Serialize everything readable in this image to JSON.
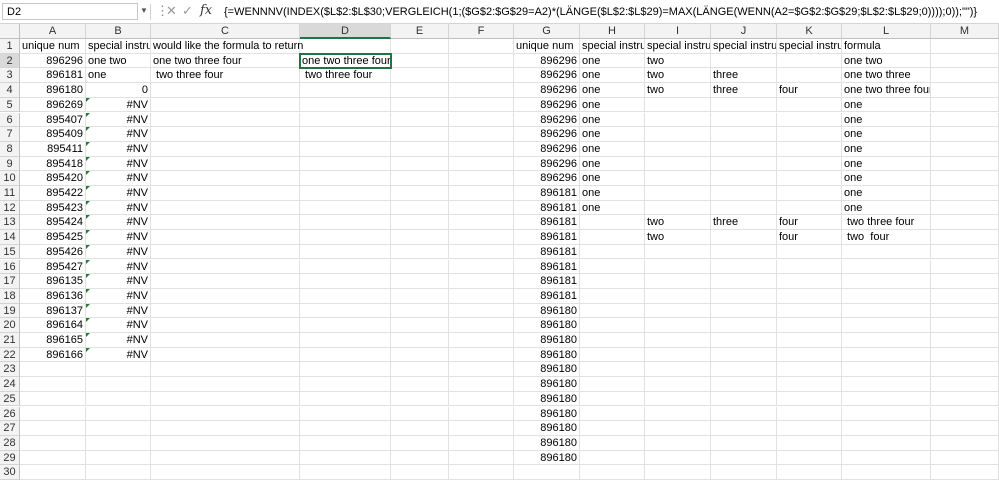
{
  "formula_bar": {
    "name_box": "D2",
    "formula": "{=WENNNV(INDEX($L$2:$L$30;VERGLEICH(1;($G$2:$G$29=A2)*(LÄNGE($L$2:$L$29)=MAX(LÄNGE(WENN(A2=$G$2:$G$29;$L$2:$L$29;0))));0));\"\")}",
    "icons": [
      "more-icon",
      "cancel-icon",
      "enter-icon",
      "insert-function-icon"
    ]
  },
  "columns": [
    "A",
    "B",
    "C",
    "D",
    "E",
    "F",
    "G",
    "H",
    "I",
    "J",
    "K",
    "L",
    "M"
  ],
  "rows": [
    "1",
    "2",
    "3",
    "4",
    "5",
    "6",
    "7",
    "8",
    "9",
    "10",
    "11",
    "12",
    "13",
    "14",
    "15",
    "16",
    "17",
    "18",
    "19",
    "20",
    "21",
    "22",
    "23",
    "24",
    "25",
    "26",
    "27",
    "28",
    "29",
    "30"
  ],
  "selected_cell": "D2",
  "theme": {
    "accent": "#217346",
    "header_bg": "#f3f3f3",
    "grid": "#e1e1e1"
  },
  "cells": [
    {
      "ref": "A1",
      "v": "unique num"
    },
    {
      "ref": "B1",
      "v": "special instruc"
    },
    {
      "ref": "C1",
      "v": "would like the formula to return",
      "ovf": true
    },
    {
      "ref": "A2",
      "v": "896296",
      "r": true
    },
    {
      "ref": "B2",
      "v": "one two"
    },
    {
      "ref": "C2",
      "v": "one two three four"
    },
    {
      "ref": "D2",
      "v": "one two three four"
    },
    {
      "ref": "A3",
      "v": "896181",
      "r": true
    },
    {
      "ref": "B3",
      "v": "one"
    },
    {
      "ref": "C3",
      "v": " two three four"
    },
    {
      "ref": "D3",
      "v": " two three four"
    },
    {
      "ref": "A4",
      "v": "896180",
      "r": true
    },
    {
      "ref": "B4",
      "v": "0",
      "r": true
    },
    {
      "ref": "A5",
      "v": "896269",
      "r": true
    },
    {
      "ref": "B5",
      "v": "#NV",
      "r": true,
      "tri": true
    },
    {
      "ref": "A6",
      "v": "895407",
      "r": true
    },
    {
      "ref": "B6",
      "v": "#NV",
      "r": true,
      "tri": true
    },
    {
      "ref": "A7",
      "v": "895409",
      "r": true
    },
    {
      "ref": "B7",
      "v": "#NV",
      "r": true,
      "tri": true
    },
    {
      "ref": "A8",
      "v": "895411",
      "r": true
    },
    {
      "ref": "B8",
      "v": "#NV",
      "r": true,
      "tri": true
    },
    {
      "ref": "A9",
      "v": "895418",
      "r": true
    },
    {
      "ref": "B9",
      "v": "#NV",
      "r": true,
      "tri": true
    },
    {
      "ref": "A10",
      "v": "895420",
      "r": true
    },
    {
      "ref": "B10",
      "v": "#NV",
      "r": true,
      "tri": true
    },
    {
      "ref": "A11",
      "v": "895422",
      "r": true
    },
    {
      "ref": "B11",
      "v": "#NV",
      "r": true,
      "tri": true
    },
    {
      "ref": "A12",
      "v": "895423",
      "r": true
    },
    {
      "ref": "B12",
      "v": "#NV",
      "r": true,
      "tri": true
    },
    {
      "ref": "A13",
      "v": "895424",
      "r": true
    },
    {
      "ref": "B13",
      "v": "#NV",
      "r": true,
      "tri": true
    },
    {
      "ref": "A14",
      "v": "895425",
      "r": true
    },
    {
      "ref": "B14",
      "v": "#NV",
      "r": true,
      "tri": true
    },
    {
      "ref": "A15",
      "v": "895426",
      "r": true
    },
    {
      "ref": "B15",
      "v": "#NV",
      "r": true,
      "tri": true
    },
    {
      "ref": "A16",
      "v": "895427",
      "r": true
    },
    {
      "ref": "B16",
      "v": "#NV",
      "r": true,
      "tri": true
    },
    {
      "ref": "A17",
      "v": "896135",
      "r": true
    },
    {
      "ref": "B17",
      "v": "#NV",
      "r": true,
      "tri": true
    },
    {
      "ref": "A18",
      "v": "896136",
      "r": true
    },
    {
      "ref": "B18",
      "v": "#NV",
      "r": true,
      "tri": true
    },
    {
      "ref": "A19",
      "v": "896137",
      "r": true
    },
    {
      "ref": "B19",
      "v": "#NV",
      "r": true,
      "tri": true
    },
    {
      "ref": "A20",
      "v": "896164",
      "r": true
    },
    {
      "ref": "B20",
      "v": "#NV",
      "r": true,
      "tri": true
    },
    {
      "ref": "A21",
      "v": "896165",
      "r": true
    },
    {
      "ref": "B21",
      "v": "#NV",
      "r": true,
      "tri": true
    },
    {
      "ref": "A22",
      "v": "896166",
      "r": true
    },
    {
      "ref": "B22",
      "v": "#NV",
      "r": true,
      "tri": true
    },
    {
      "ref": "G1",
      "v": "unique num"
    },
    {
      "ref": "H1",
      "v": "special instruc"
    },
    {
      "ref": "I1",
      "v": "special instruc"
    },
    {
      "ref": "J1",
      "v": "special instruc"
    },
    {
      "ref": "K1",
      "v": "special instruc"
    },
    {
      "ref": "L1",
      "v": "formula"
    },
    {
      "ref": "G2",
      "v": "896296",
      "r": true
    },
    {
      "ref": "H2",
      "v": "one"
    },
    {
      "ref": "I2",
      "v": "two"
    },
    {
      "ref": "L2",
      "v": "one two"
    },
    {
      "ref": "G3",
      "v": "896296",
      "r": true
    },
    {
      "ref": "H3",
      "v": "one"
    },
    {
      "ref": "I3",
      "v": "two"
    },
    {
      "ref": "J3",
      "v": "three"
    },
    {
      "ref": "L3",
      "v": "one two three"
    },
    {
      "ref": "G4",
      "v": "896296",
      "r": true
    },
    {
      "ref": "H4",
      "v": "one"
    },
    {
      "ref": "I4",
      "v": "two"
    },
    {
      "ref": "J4",
      "v": "three"
    },
    {
      "ref": "K4",
      "v": "four"
    },
    {
      "ref": "L4",
      "v": "one two three four"
    },
    {
      "ref": "G5",
      "v": "896296",
      "r": true
    },
    {
      "ref": "H5",
      "v": "one"
    },
    {
      "ref": "L5",
      "v": "one"
    },
    {
      "ref": "G6",
      "v": "896296",
      "r": true
    },
    {
      "ref": "H6",
      "v": "one"
    },
    {
      "ref": "L6",
      "v": "one"
    },
    {
      "ref": "G7",
      "v": "896296",
      "r": true
    },
    {
      "ref": "H7",
      "v": "one"
    },
    {
      "ref": "L7",
      "v": "one"
    },
    {
      "ref": "G8",
      "v": "896296",
      "r": true
    },
    {
      "ref": "H8",
      "v": "one"
    },
    {
      "ref": "L8",
      "v": "one"
    },
    {
      "ref": "G9",
      "v": "896296",
      "r": true
    },
    {
      "ref": "H9",
      "v": "one"
    },
    {
      "ref": "L9",
      "v": "one"
    },
    {
      "ref": "G10",
      "v": "896296",
      "r": true
    },
    {
      "ref": "H10",
      "v": "one"
    },
    {
      "ref": "L10",
      "v": "one"
    },
    {
      "ref": "G11",
      "v": "896181",
      "r": true
    },
    {
      "ref": "H11",
      "v": "one"
    },
    {
      "ref": "L11",
      "v": "one"
    },
    {
      "ref": "G12",
      "v": "896181",
      "r": true
    },
    {
      "ref": "H12",
      "v": "one"
    },
    {
      "ref": "L12",
      "v": "one"
    },
    {
      "ref": "G13",
      "v": "896181",
      "r": true
    },
    {
      "ref": "I13",
      "v": "two"
    },
    {
      "ref": "J13",
      "v": "three"
    },
    {
      "ref": "K13",
      "v": "four"
    },
    {
      "ref": "L13",
      "v": " two three four"
    },
    {
      "ref": "G14",
      "v": "896181",
      "r": true
    },
    {
      "ref": "I14",
      "v": "two"
    },
    {
      "ref": "K14",
      "v": "four"
    },
    {
      "ref": "L14",
      "v": " two  four"
    },
    {
      "ref": "G15",
      "v": "896181",
      "r": true
    },
    {
      "ref": "G16",
      "v": "896181",
      "r": true
    },
    {
      "ref": "G17",
      "v": "896181",
      "r": true
    },
    {
      "ref": "G18",
      "v": "896181",
      "r": true
    },
    {
      "ref": "G19",
      "v": "896180",
      "r": true
    },
    {
      "ref": "G20",
      "v": "896180",
      "r": true
    },
    {
      "ref": "G21",
      "v": "896180",
      "r": true
    },
    {
      "ref": "G22",
      "v": "896180",
      "r": true
    },
    {
      "ref": "G23",
      "v": "896180",
      "r": true
    },
    {
      "ref": "G24",
      "v": "896180",
      "r": true
    },
    {
      "ref": "G25",
      "v": "896180",
      "r": true
    },
    {
      "ref": "G26",
      "v": "896180",
      "r": true
    },
    {
      "ref": "G27",
      "v": "896180",
      "r": true
    },
    {
      "ref": "G28",
      "v": "896180",
      "r": true
    },
    {
      "ref": "G29",
      "v": "896180",
      "r": true
    }
  ]
}
